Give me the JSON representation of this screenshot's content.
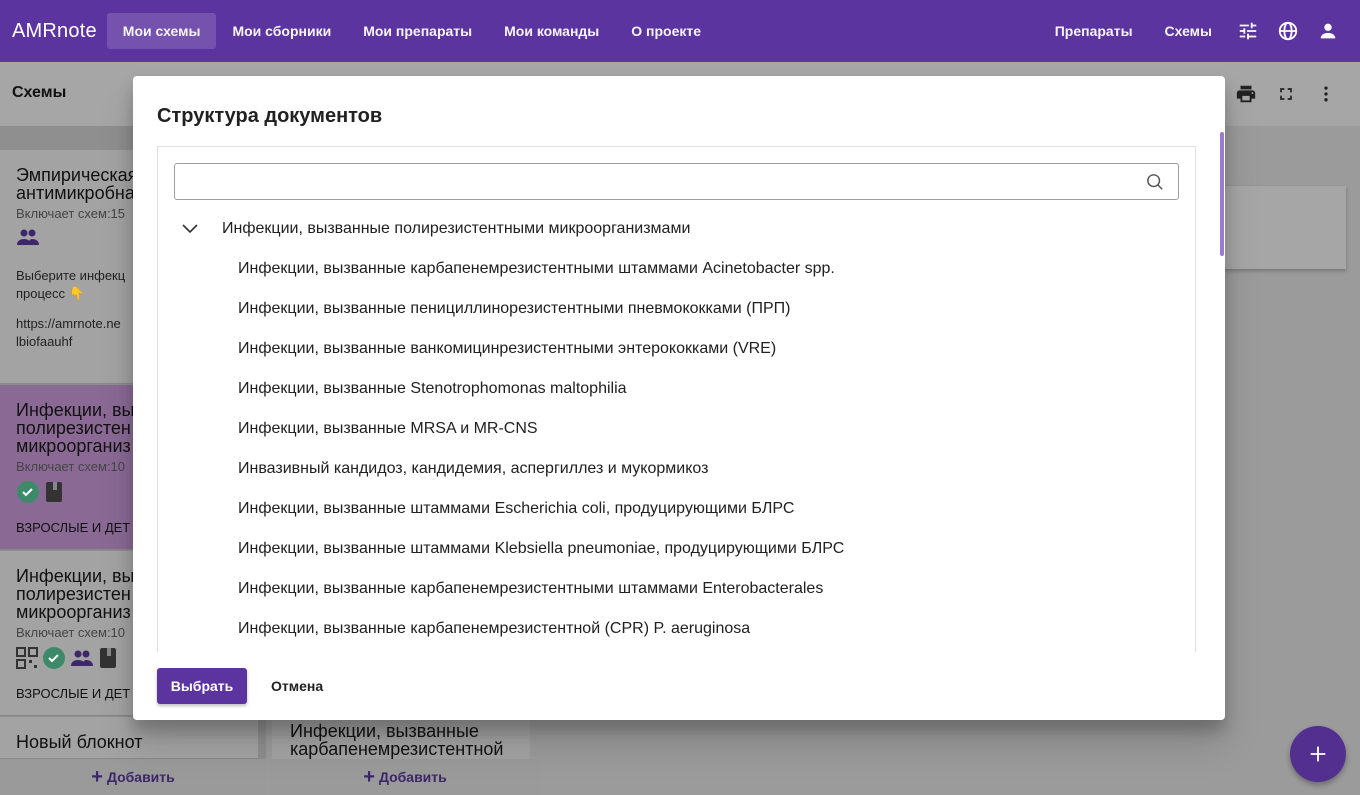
{
  "app": {
    "brand": "AMRnote",
    "nav": [
      "Мои схемы",
      "Мои сборники",
      "Мои препараты",
      "Мои команды",
      "О проекте"
    ],
    "right_links": [
      "Препараты",
      "Схемы"
    ],
    "icons": [
      "tune-icon",
      "globe-icon",
      "account-icon"
    ]
  },
  "toolbar": {
    "title": "Схемы"
  },
  "cards": [
    {
      "title": "Эмпирическая\nантимикробна",
      "sub": "Включает схем:15",
      "text1": "Выберите инфекц\nпроцесс 👇",
      "text2": "https://amrnote.ne\nlbiofaauhf"
    },
    {
      "title": "Инфекции, вы\nполирезистен\nмикроорганиз",
      "sub": "Включает схем:10",
      "tag": "ВЗРОСЛЫЕ И ДЕТ"
    },
    {
      "title": "Инфекции, вы\nполирезистен\nмикроорганиз",
      "sub": "Включает схем:10",
      "tag": "ВЗРОСЛЫЕ И ДЕТ"
    },
    {
      "title": "Новый блокнот"
    }
  ],
  "bg_card2": {
    "title": "Инфекции, вызванные\nкарбапенемрезистентной"
  },
  "add_label": "Добавить",
  "dialog": {
    "title": "Структура документов",
    "search_value": "",
    "root": "Инфекции, вызванные полирезистентными микроорганизмами",
    "items": [
      "Инфекции, вызванные карбапенемрезистентными штаммами Acinetobacter spp.",
      "Инфекции, вызванные пенициллинорезистентными пневмококками (ПРП)",
      "Инфекции, вызванные ванкомицинрезистентными энтерококками (VRE)",
      "Инфекции, вызванные Stenotrophomonas maltophilia",
      "Инфекции, вызванные MRSA и MR-CNS",
      "Инвазивный кандидоз, кандидемия, аспергиллез и мукормикоз",
      "Инфекции, вызванные штаммами Escherichia coli, продуцирующими БЛРС",
      "Инфекции, вызванные штаммами Klebsiella pneumoniae, продуцирующими БЛРС",
      "Инфекции, вызванные карбапенемрезистентными штаммами Enterobacterales",
      "Инфекции, вызванные карбапенемрезистентной (CPR) P. aeruginosa"
    ],
    "select_label": "Выбрать",
    "cancel_label": "Отмена"
  },
  "colors": {
    "primary": "#5b34a0",
    "accent": "#9c7ad0"
  }
}
